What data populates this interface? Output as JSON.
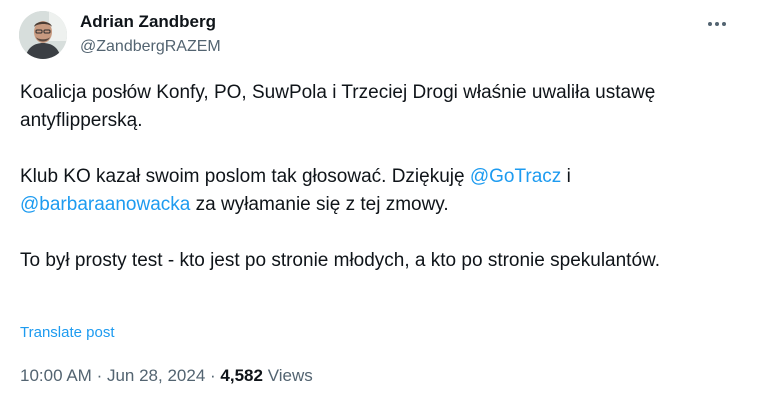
{
  "author": {
    "display_name": "Adrian Zandberg",
    "handle": "@ZandbergRAZEM"
  },
  "post": {
    "paragraph_1": "Koalicja posłów Konfy, PO, SuwPola i Trzeciej Drogi właśnie uwaliła ustawę antyflipperską.",
    "paragraph_2_a": "Klub KO kazał swoim poslom tak głosować. Dziękuję ",
    "mention_1": "@GoTracz",
    "paragraph_2_b": " i ",
    "mention_2": "@barbaraanowacka",
    "paragraph_2_c": " za wyłamanie się z tej zmowy.",
    "paragraph_3": "To był prosty test - kto jest po stronie młodych, a kto po stronie spekulantów."
  },
  "translate_label": "Translate post",
  "meta": {
    "time": "10:00 AM",
    "separator": "·",
    "date": "Jun 28, 2024",
    "views_count": "4,582",
    "views_label": "Views"
  },
  "icons": {
    "more": "more-horizontal-icon",
    "avatar": "profile-photo"
  },
  "colors": {
    "link": "#1d9bf0",
    "secondary_text": "#536471",
    "primary_text": "#0f1419"
  }
}
